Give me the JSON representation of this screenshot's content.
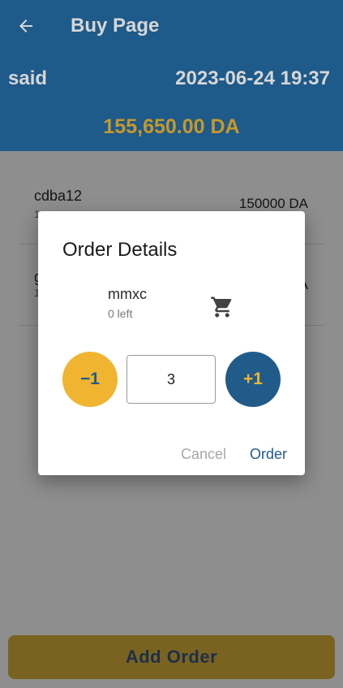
{
  "appbar": {
    "title": "Buy Page",
    "back_icon": "arrow-left-icon"
  },
  "header": {
    "user": "said",
    "datetime": "2023-06-24 19:37",
    "balance": "155,650.00 DA"
  },
  "items": [
    {
      "name": "cdba12",
      "sub": "1",
      "price": "150000 DA"
    },
    {
      "name": "g",
      "sub": "1",
      "price": "A"
    }
  ],
  "add_order_label": "Add Order",
  "dialog": {
    "title": "Order Details",
    "product_name": "mmxc",
    "stock_left": "0 left",
    "cart_icon": "shopping-cart-icon",
    "minus_label": "−1",
    "plus_label": "+1",
    "quantity": "3",
    "cancel_label": "Cancel",
    "order_label": "Order"
  },
  "colors": {
    "primary": "#215b8a",
    "accent": "#f0b430",
    "balance_text": "#c7982a"
  }
}
